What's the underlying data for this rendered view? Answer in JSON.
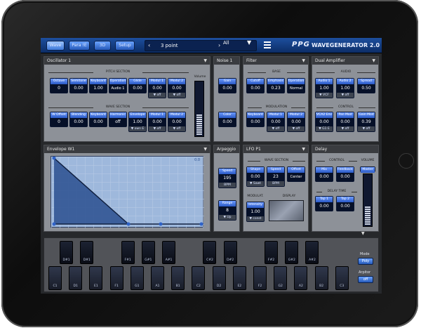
{
  "toolbar": {
    "modes": [
      {
        "label": "Wave",
        "active": true
      },
      {
        "label": "Para !E",
        "active": false
      },
      {
        "label": "3D",
        "active": false
      },
      {
        "label": "Setup",
        "active": false
      }
    ],
    "prev_glyph": "‹",
    "next_glyph": "›",
    "preset_name": "3 point",
    "bank_next_glyph": "›",
    "bank": "All",
    "bank_drop_glyph": "▼",
    "logo": "PPG",
    "title": "WAVEGENERATOR 2.0"
  },
  "oscillator": {
    "title": "Oscillator 1",
    "pitch_section": "PITCH SECTION",
    "wave_section": "WAVE SECTION",
    "volume": "Volume",
    "pitch_knobs": [
      {
        "label": "Octave",
        "value": "0",
        "sub": ""
      },
      {
        "label": "Semitone",
        "value": "0.00",
        "sub": ""
      },
      {
        "label": "Keyboard",
        "value": "1.00",
        "sub": ""
      },
      {
        "label": "Operation",
        "value": "Audio 1",
        "sub": ""
      },
      {
        "label": "Glide",
        "value": "0.00",
        "sub": ""
      },
      {
        "label": "Modul 1",
        "value": "0.00",
        "sub": "▼ off"
      },
      {
        "label": "Modul 2",
        "value": "0.00",
        "sub": "▼ off"
      }
    ],
    "wave_knobs": [
      {
        "label": "W Offset",
        "value": "0",
        "sub": ""
      },
      {
        "label": "Blending",
        "value": "0.00",
        "sub": ""
      },
      {
        "label": "Keyboard",
        "value": "0.00",
        "sub": ""
      },
      {
        "label": "Harmonic",
        "value": "off",
        "sub": ""
      },
      {
        "label": "Envelope",
        "value": "1.00",
        "sub": "▼ own E"
      },
      {
        "label": "Modul 1",
        "value": "0.00",
        "sub": "▼ off"
      },
      {
        "label": "Modul 2",
        "value": "0.00",
        "sub": "▼ off"
      }
    ]
  },
  "noise": {
    "title": "Noise 1",
    "knobs": [
      {
        "label": "Gain",
        "value": "0.00"
      },
      {
        "label": "Color",
        "value": "0.00"
      }
    ]
  },
  "filter": {
    "title": "Filter",
    "base": "BASE",
    "modulation": "MODULATION",
    "base_knobs": [
      {
        "label": "Cutoff",
        "value": "0.00"
      },
      {
        "label": "Emphasis",
        "value": "0.23"
      },
      {
        "label": "Operation",
        "value": "Normal"
      }
    ],
    "mod_knobs": [
      {
        "label": "Keyboard",
        "value": "0.00",
        "sub": ""
      },
      {
        "label": "Modul 1",
        "value": "0.00",
        "sub": "▼ off"
      },
      {
        "label": "Modul 2",
        "value": "0.00",
        "sub": "▼ off"
      }
    ]
  },
  "amp": {
    "title": "Dual Amplifier",
    "audio": "AUDIO",
    "control": "CONTROL",
    "audio_knobs": [
      {
        "label": "Audio 1",
        "value": "1.00",
        "sub": "▼ VCF"
      },
      {
        "label": "Audio 2",
        "value": "1.00",
        "sub": "▼ off"
      },
      {
        "label": "Spread",
        "value": "0.50",
        "sub": ""
      }
    ],
    "control_knobs": [
      {
        "label": "VCA2 Env",
        "value": "0.00",
        "sub": "▼ G1 E"
      },
      {
        "label": "Pan Mod",
        "value": "0.00",
        "sub": "▼ off"
      },
      {
        "label": "Gain Mod",
        "value": "0.39",
        "sub": "▼ off"
      }
    ]
  },
  "envelope": {
    "title": "Envelope W1",
    "readout": "0.0"
  },
  "arpeggio": {
    "title": "Arpeggio",
    "knobs": [
      {
        "label": "Speed",
        "value": "195",
        "sub": "BPM"
      },
      {
        "label": "Range",
        "value": "8",
        "sub": "▼ Up"
      }
    ]
  },
  "lfo": {
    "title": "LFO P1",
    "wave_section": "WAVE SECTION",
    "modulat": "MODULAT.",
    "display": "DISPLAY",
    "knobs": [
      {
        "label": "Shape",
        "value": "0.00",
        "sub": "▼ Sawt"
      },
      {
        "label": "Speed",
        "value": "23",
        "sub": "BPM"
      },
      {
        "label": "Offset",
        "value": "Center",
        "sub": ""
      }
    ],
    "intensity": {
      "label": "Intensity",
      "value": "1.00",
      "sub": "▼ const"
    }
  },
  "delay": {
    "title": "Delay",
    "control": "CONTROL",
    "delay_time": "DELAY TIME",
    "volume": "VOLUME",
    "knobs": [
      {
        "label": "Mix",
        "value": "0.00"
      },
      {
        "label": "Feedback",
        "value": "0.00"
      },
      {
        "label": "Tap 1",
        "value": "0.00"
      },
      {
        "label": "Tap 2",
        "value": "0.00"
      }
    ],
    "master": "Master"
  },
  "keyboard": {
    "white_keys": [
      "C1",
      "D1",
      "E1",
      "F1",
      "G1",
      "A1",
      "B1",
      "C2",
      "D2",
      "E2",
      "F2",
      "G2",
      "A2",
      "B2",
      "C3"
    ],
    "black_keys": [
      "D#1",
      "D#1",
      "F#1",
      "G#1",
      "A#1",
      "C#2",
      "D#2",
      "F#2",
      "G#2",
      "A#2"
    ],
    "mode_label": "Mode",
    "mode_value": "Poly",
    "arp_label": "Arpitor",
    "arp_value": "off",
    "drop_glyph": "▼"
  }
}
